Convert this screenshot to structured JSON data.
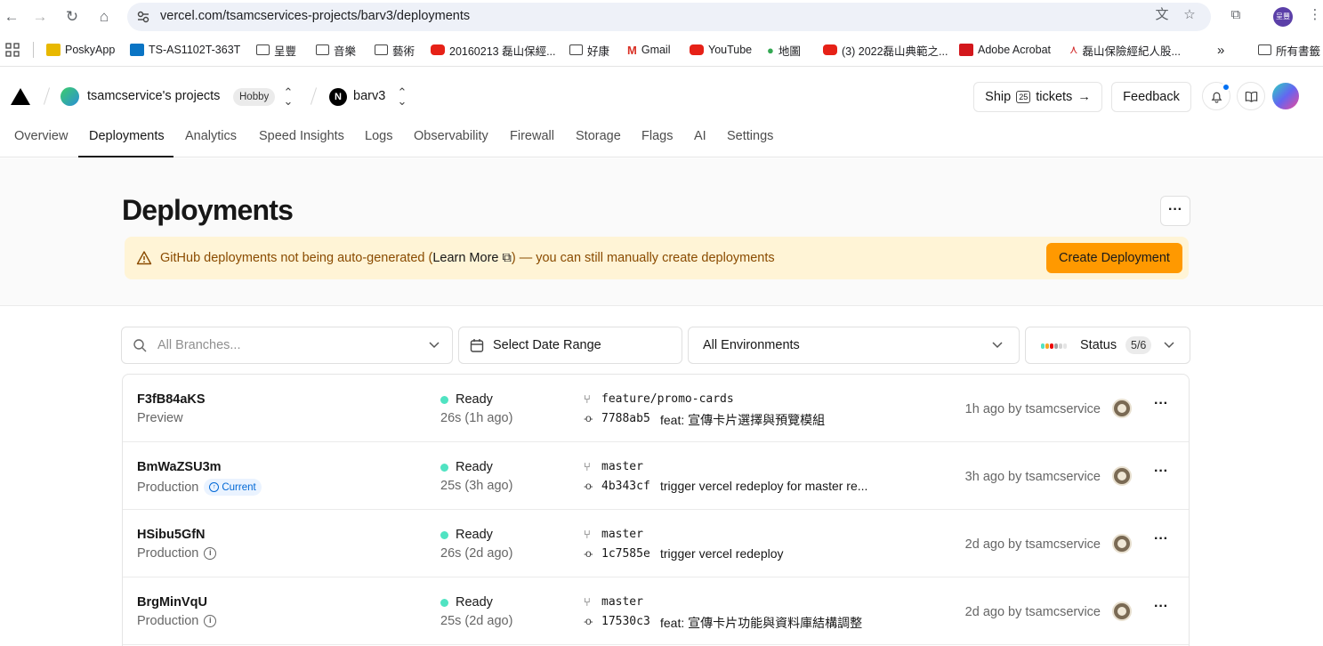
{
  "browser": {
    "url": "vercel.com/tsamcservices-projects/barv3/deployments",
    "profile_initials": "呈豐",
    "bookmarks": [
      {
        "label": "PoskyApp",
        "icon": "posky-icon"
      },
      {
        "label": "TS-AS1102T-363T",
        "icon": "nas-icon"
      },
      {
        "label": "呈豐",
        "icon": "folder-icon"
      },
      {
        "label": "音樂",
        "icon": "folder-icon"
      },
      {
        "label": "藝術",
        "icon": "folder-icon"
      },
      {
        "label": "20160213 磊山保經...",
        "icon": "youtube-icon"
      },
      {
        "label": "好康",
        "icon": "folder-icon"
      },
      {
        "label": "Gmail",
        "icon": "gmail-icon"
      },
      {
        "label": "YouTube",
        "icon": "youtube-icon"
      },
      {
        "label": "地圖",
        "icon": "maps-icon"
      },
      {
        "label": "(3) 2022磊山典範之...",
        "icon": "youtube-icon"
      },
      {
        "label": "Adobe Acrobat",
        "icon": "acrobat-icon"
      },
      {
        "label": "磊山保險經紀人股...",
        "icon": "company-icon"
      }
    ],
    "more_bookmarks": "»",
    "all_bookmarks": "所有書籤"
  },
  "header": {
    "team_name": "tsamcservice's projects",
    "plan_badge": "Hobby",
    "project_name": "barv3",
    "ship_label_pre": "Ship",
    "ship_badge": "25",
    "ship_label_post": "tickets",
    "feedback_label": "Feedback"
  },
  "tabs": [
    "Overview",
    "Deployments",
    "Analytics",
    "Speed Insights",
    "Logs",
    "Observability",
    "Firewall",
    "Storage",
    "Flags",
    "AI",
    "Settings"
  ],
  "active_tab": "Deployments",
  "page": {
    "title": "Deployments",
    "banner_pre": "GitHub deployments not being auto-generated (",
    "banner_link": "Learn More",
    "banner_post": ") — you can still manually create deployments",
    "create_button": "Create Deployment"
  },
  "filters": {
    "branches_placeholder": "All Branches...",
    "date_range": "Select Date Range",
    "environments": "All Environments",
    "status_label": "Status",
    "status_count": "5/6",
    "status_colors": [
      "#50e3c2",
      "#f5a623",
      "#ee0000",
      "#a1a1a1",
      "#d4d4d4",
      "#e5e5e5"
    ]
  },
  "deployments": [
    {
      "id": "F3fB84aKS",
      "env": "Preview",
      "current": false,
      "info": false,
      "status": "Ready",
      "duration": "26s (1h ago)",
      "branch": "feature/promo-cards",
      "hash": "7788ab5",
      "message": "feat: 宣傳卡片選擇與預覽模組",
      "meta": "1h ago by tsamcservice"
    },
    {
      "id": "BmWaZSU3m",
      "env": "Production",
      "current": true,
      "current_label": "Current",
      "info": false,
      "status": "Ready",
      "duration": "25s (3h ago)",
      "branch": "master",
      "hash": "4b343cf",
      "message": "trigger vercel redeploy for master re...",
      "meta": "3h ago by tsamcservice"
    },
    {
      "id": "HSibu5GfN",
      "env": "Production",
      "current": false,
      "info": true,
      "status": "Ready",
      "duration": "26s (2d ago)",
      "branch": "master",
      "hash": "1c7585e",
      "message": "trigger vercel redeploy",
      "meta": "2d ago by tsamcservice"
    },
    {
      "id": "BrgMinVqU",
      "env": "Production",
      "current": false,
      "info": true,
      "status": "Ready",
      "duration": "25s (2d ago)",
      "branch": "master",
      "hash": "17530c3",
      "message": "feat: 宣傳卡片功能與資料庫結構調整",
      "meta": "2d ago by tsamcservice"
    }
  ],
  "colors": {
    "accent": "#ff9900",
    "ready": "#50e3c2",
    "banner_bg": "#fff4d6",
    "banner_text": "#8a4b00"
  }
}
